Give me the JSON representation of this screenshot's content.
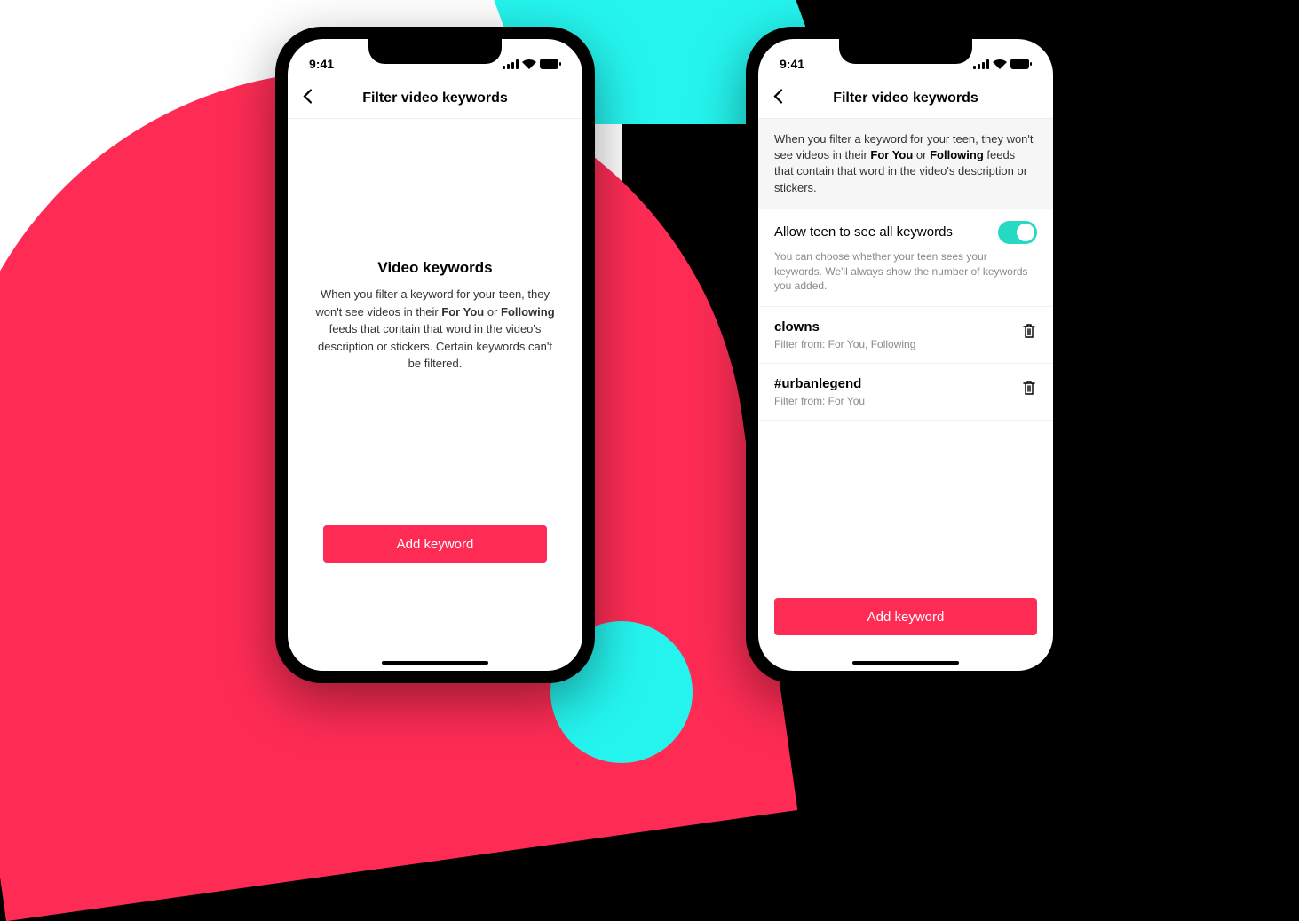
{
  "status": {
    "time": "9:41"
  },
  "header": {
    "title": "Filter video keywords"
  },
  "left": {
    "empty_title": "Video keywords",
    "empty_text_pre": "When you filter a keyword for your teen, they won't see videos in their ",
    "empty_bold1": "For You",
    "empty_mid": " or ",
    "empty_bold2": "Following",
    "empty_text_post": " feeds that contain that word in the video's description or stickers. Certain keywords can't be filtered.",
    "button": "Add keyword"
  },
  "right": {
    "explain_pre": "When you filter a keyword for your teen, they won't see videos in their ",
    "explain_bold1": "For You",
    "explain_mid": " or ",
    "explain_bold2": "Following",
    "explain_post": " feeds that contain that word in the video's description or stickers.",
    "toggle_label": "Allow teen to see all keywords",
    "toggle_sub": "You can choose whether your teen sees your keywords. We'll always show the number of keywords you added.",
    "keywords": [
      {
        "word": "clowns",
        "sub": "Filter from: For You, Following"
      },
      {
        "word": "#urbanlegend",
        "sub": "Filter from: For You"
      }
    ],
    "button": "Add keyword"
  }
}
